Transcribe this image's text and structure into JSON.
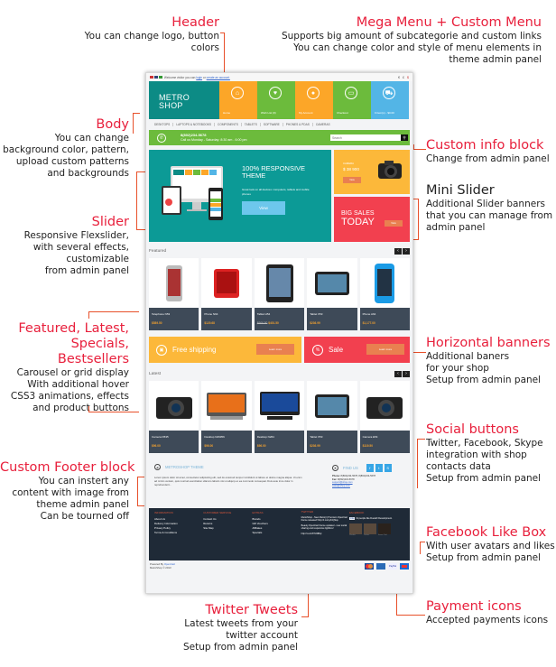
{
  "annotations": {
    "header": {
      "title": "Header",
      "desc": "You can change logo, button colors"
    },
    "mega_menu": {
      "title": "Mega Menu + Custom Menu",
      "lines": [
        "Supports big amount of subcategorie and custom links",
        "You can change color and style of menu elements in",
        "theme admin panel"
      ]
    },
    "body": {
      "title": "Body",
      "lines": [
        "You can change",
        "background color, pattern,",
        "upload custom patterns",
        "and backgrounds"
      ]
    },
    "slider": {
      "title": "Slider",
      "lines": [
        "Responsive Flexslider,",
        "with several effects,",
        "customizable",
        "from admin panel"
      ]
    },
    "custom_info": {
      "title": "Custom info block",
      "desc": "Change from admin panel"
    },
    "mini_slider": {
      "title": "Mini Slider",
      "lines": [
        "Additional Slider banners",
        "that you can manage from",
        "admin panel"
      ]
    },
    "featured": {
      "title_lines": [
        "Featured, Latest,",
        "Specials, Bestsellers"
      ],
      "lines": [
        "Carousel or grid display",
        "With additional hover",
        "CSS3 animations, effects",
        "and product buttons"
      ]
    },
    "horizontal_banners": {
      "title": "Horizontal banners",
      "lines": [
        "Additional baners",
        "for your shop",
        "Setup from admin panel"
      ]
    },
    "social": {
      "title": "Social buttons",
      "lines": [
        "Twitter, Facebook, Skype",
        "integration with shop",
        "contacts data",
        "Setup from admin panel"
      ]
    },
    "custom_footer": {
      "title": "Custom Footer block",
      "lines": [
        "You can instert any",
        "content with image from",
        "theme admin panel",
        "Can be tourned off"
      ]
    },
    "facebook": {
      "title": "Facebook Like Box",
      "lines": [
        "With user avatars and likes",
        "Setup from admin panel"
      ]
    },
    "payment": {
      "title": "Payment icons",
      "desc": "Accepted payments icons"
    },
    "twitter": {
      "title": "Twitter Tweets",
      "lines": [
        "Latest tweets from your",
        "twitter account",
        "Setup from admin panel"
      ]
    }
  },
  "site": {
    "topbar": {
      "welcome": "Welcome visitor you can",
      "login": "login",
      "or": "or",
      "create": "create an account."
    },
    "logo": [
      "METRO",
      "SHOP"
    ],
    "tiles": [
      {
        "label": "Home",
        "icon": "home-icon",
        "glyph": "⌂",
        "color": "#fca628"
      },
      {
        "label": "Wish List (0)",
        "icon": "heart-icon",
        "glyph": "♥",
        "color": "#6cbb3c"
      },
      {
        "label": "My Account",
        "icon": "user-icon",
        "glyph": "👤",
        "color": "#fca628"
      },
      {
        "label": "Checkout",
        "icon": "card-icon",
        "glyph": "▭",
        "color": "#6cbb3c"
      },
      {
        "label": "0 item(s) - $0.00",
        "icon": "cart-icon",
        "glyph": "🛒",
        "color": "#53b5e6"
      }
    ],
    "menu": [
      "DESKTOPS",
      "LAPTOPS & NOTEBOOKS",
      "COMPONENTS",
      "TABLETS",
      "SOFTWARE",
      "PHONES & PDAS",
      "CAMERAS"
    ],
    "info": {
      "phone": "8(802)234-5678",
      "hours": "Call us Monday - Saturday: 8:30 am - 6:00 pm",
      "search_placeholder": "Search"
    },
    "slider": {
      "title": "100% RESPONSIVE THEME",
      "text": "Great look on all devices: computers, tablets and mobile phones",
      "button": "View"
    },
    "mini": {
      "camera_caption": "CAMERA",
      "camera_price": "$ 38 900",
      "view": "View",
      "big_sales": "BIG SALES",
      "today": "TODAY"
    },
    "featured": {
      "title": "Featured",
      "products": [
        {
          "name": "Telephone N53",
          "price": "$589.50",
          "old": ""
        },
        {
          "name": "Phone N64",
          "price": "$120.68",
          "old": ""
        },
        {
          "name": "Tablet H54",
          "price": "$401.50",
          "old": "$606.50"
        },
        {
          "name": "Tablet X53",
          "price": "$236.99",
          "old": ""
        },
        {
          "name": "Phone A64",
          "price": "$1,177.00",
          "old": ""
        }
      ]
    },
    "banners": {
      "shipping": "Free shipping",
      "sale": "Sale",
      "learn": "Learn more"
    },
    "latest": {
      "title": "Latest",
      "products": [
        {
          "name": "Camera D535",
          "price": "$96.00"
        },
        {
          "name": "Desktop N26356",
          "price": "$96.00"
        },
        {
          "name": "Desktop N264",
          "price": "$96.00"
        },
        {
          "name": "Tablet X53",
          "price": "$236.99"
        },
        {
          "name": "Camera E54",
          "price": "$119.50"
        }
      ]
    },
    "custom_block": {
      "title": "METROSHOP THEME",
      "text": "Lorem ipsum dolor sit amet, consectetur adipisicing elit, sed do eiusmod tempor incididunt ut labore et dolore magna aliqua. Ut enim ad minim veniam, quis nostrud exercitation ullamco laboris nisi ut aliquip ex ea commodo consequat. Duis aute irure dolor in reprehenderit...",
      "find_us": "FIND US",
      "phone_label": "Phone:",
      "phone": "8(802)234-5678, 8(802)234-5678",
      "fax_label": "Fax:",
      "fax": "8(802)234-5678",
      "email1": "support@shop.com",
      "email2": "sales@shop.com"
    },
    "footer": {
      "information": {
        "title": "INFORMATION",
        "links": [
          "About Us",
          "Delivery Information",
          "Privacy Policy",
          "Terms & Conditions"
        ]
      },
      "customer": {
        "title": "CUSTOMER SERVICE",
        "links": [
          "Contact Us",
          "Returns",
          "Site Map"
        ]
      },
      "extras": {
        "title": "EXTRAS",
        "links": [
          "Brands",
          "Gift Vouchers",
          "Affiliates",
          "Specials"
        ]
      },
      "twitter": {
        "title": "TWITTER",
        "tweets": [
          "MetroShop - New Metro(r) Premium OpenCart theme released! http://t.co/xy/brQ9qx",
          "Beauty OpenCart theme updated - new social sharing and responsive lightbox!",
          "http://t.co/n8TJWBqI"
        ]
      },
      "facebook": {
        "title": "FACEBOOK",
        "like": "Like",
        "like_text": "31 people like DuelaX Development.",
        "users": [
          "Charlie",
          "Carlos",
          "Sean Olaf"
        ]
      }
    },
    "powered": "Powered By",
    "opencart": "OpenCart",
    "copyright": "MetroShop © 2013",
    "payments": [
      "mastercard-icon",
      "amex-icon",
      "paypal-icon",
      "maestro-icon"
    ]
  }
}
